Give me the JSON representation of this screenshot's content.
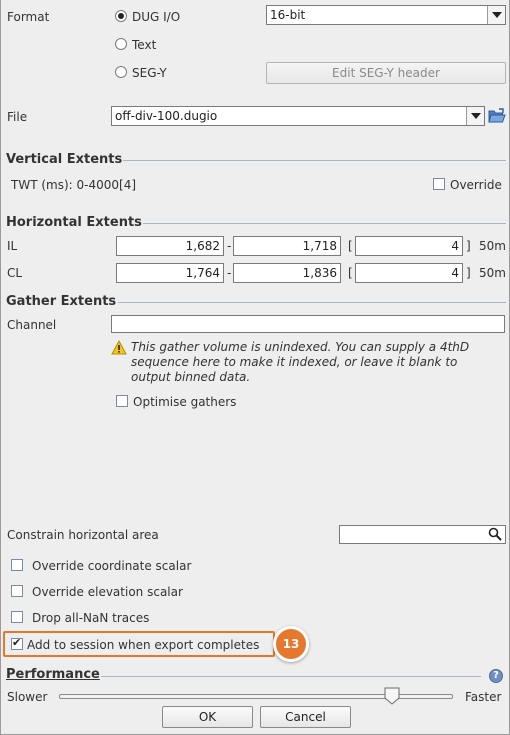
{
  "format": {
    "label": "Format",
    "options": [
      "DUG I/O",
      "Text",
      "SEG-Y"
    ],
    "selected_option": "DUG I/O",
    "bit_depth": "16-bit",
    "edit_segy_button": "Edit SEG-Y header"
  },
  "file": {
    "label": "File",
    "value": "off-div-100.dugio"
  },
  "vertical": {
    "title": "Vertical Extents",
    "twt": "TWT (ms): 0-4000[4]",
    "override_label": "Override",
    "override_checked": false
  },
  "horizontal": {
    "title": "Horizontal Extents",
    "rows": [
      {
        "label": "IL",
        "from": "1,682",
        "sep": "-",
        "to": "1,718",
        "open": "[",
        "step": "4",
        "close": "]",
        "unit": "50m"
      },
      {
        "label": "CL",
        "from": "1,764",
        "sep": "-",
        "to": "1,836",
        "open": "[",
        "step": "4",
        "close": "]",
        "unit": "50m"
      }
    ]
  },
  "gather": {
    "title": "Gather Extents",
    "channel_label": "Channel",
    "channel_value": "",
    "warning_line1": "This gather volume is unindexed. You can supply a 4thD",
    "warning_line2": "sequence here to make it indexed, or leave it blank to",
    "warning_line3": "output binned data.",
    "optimise_label": "Optimise gathers",
    "optimise_checked": false
  },
  "constrain": {
    "label": "Constrain horizontal area",
    "value": ""
  },
  "options": {
    "override_coord": "Override coordinate scalar",
    "override_elev": "Override elevation scalar",
    "drop_nan": "Drop all-NaN traces",
    "add_session": "Add to session when export completes",
    "add_session_checked": true,
    "callout_number": "13"
  },
  "performance": {
    "title": "Performance",
    "slower": "Slower",
    "faster": "Faster",
    "slider_value": 0.86
  },
  "buttons": {
    "ok": "OK",
    "cancel": "Cancel"
  },
  "colors": {
    "callout": "#e8772e",
    "section_line": "#a8b6c8",
    "help_icon": "#6f8fbf"
  }
}
